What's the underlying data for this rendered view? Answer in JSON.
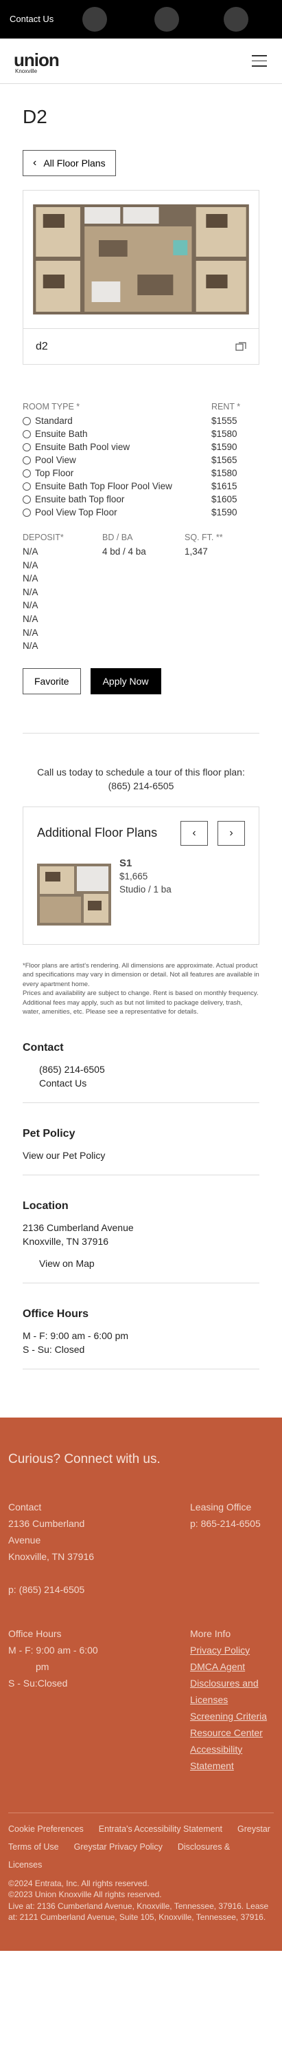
{
  "topbar": {
    "contact": "Contact Us"
  },
  "logo": {
    "word": "union",
    "sub": "Knoxville"
  },
  "plan": {
    "title": "D2",
    "back_label": "All Floor Plans",
    "caption": "d2"
  },
  "room_type": {
    "label": "ROOM TYPE *",
    "options": [
      "Standard",
      "Ensuite Bath",
      "Ensuite Bath Pool view",
      "Pool View",
      "Top Floor",
      "Ensuite Bath Top Floor Pool View",
      "Ensuite bath Top floor",
      "Pool View Top Floor"
    ]
  },
  "rent": {
    "label": "RENT *",
    "values": [
      "$1555",
      "$1580",
      "$1590",
      "$1565",
      "$1580",
      "$1615",
      "$1605",
      "$1590"
    ]
  },
  "deposit": {
    "label": "DEPOSIT*",
    "values": [
      "N/A",
      "N/A",
      "N/A",
      "N/A",
      "N/A",
      "N/A",
      "N/A",
      "N/A"
    ]
  },
  "bdba": {
    "label": "BD / BA",
    "value": "4 bd / 4 ba"
  },
  "sqft": {
    "label": "SQ. FT. **",
    "value": "1,347"
  },
  "buttons": {
    "favorite": "Favorite",
    "apply": "Apply Now"
  },
  "call": {
    "text": "Call us today to schedule a tour of this floor plan:",
    "phone": "(865) 214-6505"
  },
  "additional": {
    "title": "Additional Floor Plans",
    "unit_name": "S1",
    "unit_price": "$1,665",
    "unit_type": "Studio / 1 ba"
  },
  "disclaimer": {
    "p1": "*Floor plans are artist's rendering. All dimensions are approximate. Actual product and specifications may vary in dimension or detail. Not all features are available in every apartment home.",
    "p2": "Prices and availability are subject to change. Rent is based on monthly frequency. Additional fees may apply, such as but not limited to package delivery, trash, water, amenities, etc. Please see a representative for details."
  },
  "contact": {
    "heading": "Contact",
    "phone": "(865) 214-6505",
    "link": "Contact Us"
  },
  "pet": {
    "heading": "Pet Policy",
    "link": "View our Pet Policy"
  },
  "location": {
    "heading": "Location",
    "line1": "2136 Cumberland Avenue",
    "line2": "Knoxville, TN 37916",
    "map": "View on Map"
  },
  "hours": {
    "heading": "Office Hours",
    "weekday": "M - F:  9:00 am - 6:00 pm",
    "weekend": "S - Su:  Closed"
  },
  "footer": {
    "curious": "Curious? Connect with us.",
    "contact_label": "Contact",
    "address1": "2136 Cumberland",
    "address2": "Avenue",
    "address3": "Knoxville, TN 37916",
    "phone": "p: (865) 214-6505",
    "leasing_label": "Leasing Office",
    "leasing_phone": "p: 865-214-6505",
    "hours_label": "Office Hours",
    "hours_mf": "M - F: 9:00 am - 6:00",
    "hours_mf2": "pm",
    "hours_ss": "S - Su:Closed",
    "more_label": "More Info",
    "more_links": [
      "Privacy Policy",
      "DMCA Agent",
      "Disclosures and Licenses",
      "Screening Criteria",
      "Resource Center",
      "Accessibility Statement"
    ],
    "bottom_links": [
      "Cookie Preferences",
      "Entrata's Accessibility Statement",
      "Greystar Terms of Use",
      "Greystar Privacy Policy",
      "Disclosures & Licenses"
    ],
    "copy1": "©2024 Entrata, Inc. All rights reserved.",
    "copy2": "©2023 Union Knoxville All rights reserved.",
    "copy3": "Live at: 2136 Cumberland Avenue, Knoxville, Tennessee, 37916. Lease at: 2121 Cumberland Avenue, Suite 105, Knoxville, Tennessee, 37916."
  }
}
